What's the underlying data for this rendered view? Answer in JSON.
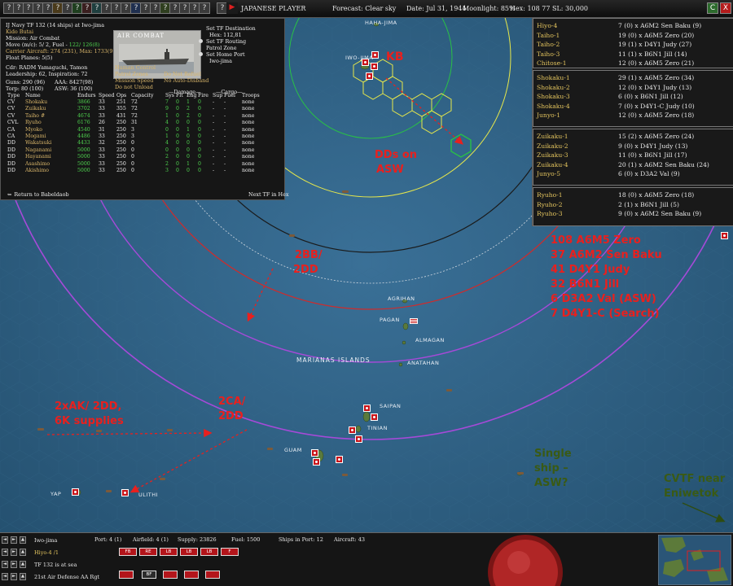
{
  "topbar": {
    "side_label": "JAPANESE PLAYER",
    "forecast": "Forecast: Clear sky",
    "date": "Date: Jul 31, 1944",
    "moonlight": "Moonlight: 85%",
    "hex": "Hex: 108  77  SL: 30,000",
    "buttons": [
      "?",
      "?",
      "?",
      "?",
      "?",
      "?",
      "?",
      "?",
      "?",
      "?",
      "?",
      "?",
      "?",
      "?",
      "?",
      "?",
      "?",
      "?",
      "?",
      "?",
      "?",
      "?",
      "▶"
    ],
    "window_buttons": [
      "C",
      "X"
    ]
  },
  "tf_panel": {
    "line1": "IJ Navy TF 132 (14 ships) at Iwo-jima",
    "line2": "Kido Butai",
    "line3": "Mission: Air Combat",
    "line4a": "Move (m/c): 5/ 2, Fuel - ",
    "line4b": "122/ 126(8)",
    "line5": "Carrier Aircraft: 274 (231), Max: 1733(90%)",
    "line6": "Float Planes: 5(5)",
    "cdr": "Cdr:  RADM  Yamaguchi, Tamon",
    "leadership": "Leadership: 62, Inspiration: 72",
    "guns": "Guns: 290 (96)",
    "torps": "Torp: 80 (100)",
    "aaa": "AAA: 8427(98)",
    "asw": "ASW: 36 (100)",
    "air_combat_title": "AIR COMBAT",
    "options": [
      "Set TF Destination",
      "Hex: 112,81",
      "Set TF Routing",
      "Patrol Zone",
      "Set Home Port",
      "Iwo-jima"
    ],
    "lower_left": [
      "Human Control",
      "Patrol Zones",
      "Mission Speed",
      "Do not Unload"
    ],
    "lower_right": [
      "Do Not Refuel",
      "No Auto-Disband"
    ],
    "damage_header": "—Damage—",
    "cargo_header": "—Cargo—",
    "columns": [
      "Type",
      "Name",
      "Endurs",
      "Speed",
      "Ops",
      "Capacity",
      "Sys",
      "Flt",
      "Eng",
      "Fire",
      "Sup",
      "Fuel",
      "Troops"
    ],
    "ships": [
      [
        "CV",
        "Shokaku",
        "3866",
        "33",
        "251",
        "72",
        "7",
        "0",
        "1",
        "0",
        "-",
        "-",
        "none"
      ],
      [
        "CV",
        "Zuikaku",
        "3702",
        "33",
        "355",
        "72",
        "9",
        "0",
        "2",
        "0",
        "-",
        "-",
        "none"
      ],
      [
        "CV",
        "Taiho #",
        "4674",
        "33",
        "431",
        "72",
        "1",
        "0",
        "2",
        "0",
        "-",
        "-",
        "none"
      ],
      [
        "CVL",
        "Ryuho",
        "6176",
        "26",
        "250",
        "31",
        "4",
        "0",
        "0",
        "0",
        "-",
        "-",
        "none"
      ],
      [
        "CA",
        "Myoko",
        "4540",
        "31",
        "250",
        "3",
        "0",
        "0",
        "1",
        "0",
        "-",
        "-",
        "none"
      ],
      [
        "CA",
        "Mogami",
        "4486",
        "33",
        "250",
        "3",
        "1",
        "0",
        "0",
        "0",
        "-",
        "-",
        "none"
      ],
      [
        "DD",
        "Wakatsuki",
        "4433",
        "32",
        "250",
        "0",
        "4",
        "0",
        "0",
        "0",
        "-",
        "-",
        "none"
      ],
      [
        "DD",
        "Naganami",
        "5000",
        "33",
        "250",
        "0",
        "0",
        "0",
        "0",
        "0",
        "-",
        "-",
        "none"
      ],
      [
        "DD",
        "Hayanami",
        "5000",
        "33",
        "250",
        "0",
        "2",
        "0",
        "0",
        "0",
        "-",
        "-",
        "none"
      ],
      [
        "DD",
        "Asashimo",
        "5000",
        "33",
        "250",
        "0",
        "2",
        "0",
        "1",
        "0",
        "-",
        "-",
        "none"
      ],
      [
        "DD",
        "Akishimo",
        "5000",
        "33",
        "250",
        "0",
        "3",
        "0",
        "0",
        "0",
        "-",
        "-",
        "none"
      ]
    ],
    "return_label": "Return to Babeldaob",
    "next_tf_label": "Next TF in Hex"
  },
  "air_groups": {
    "block1": [
      [
        "Hiyo-4",
        "7 (0) x A6M2 Sen Baku (9)"
      ],
      [
        "Taiho-1",
        "19 (0) x A6M5 Zero (20)"
      ],
      [
        "Taiho-2",
        "19 (1) x D4Y1 Judy (27)"
      ],
      [
        "Taiho-3",
        "11 (1) x B6N1 Jill (14)"
      ],
      [
        "Chitose-1",
        "12 (0) x A6M5 Zero (21)"
      ]
    ],
    "block2": [
      [
        "Shokaku-1",
        "29 (1) x A6M5 Zero (34)"
      ],
      [
        "Shokaku-2",
        "12 (0) x D4Y1 Judy (13)"
      ],
      [
        "Shokaku-3",
        "6 (0) x B6N1 Jill (12)"
      ],
      [
        "Shokaku-4",
        "7 (0) x D4Y1-C Judy (10)"
      ],
      [
        "Junyo-1",
        "12 (0) x A6M5 Zero (18)"
      ]
    ],
    "block3": [
      [
        "Zuikaku-1",
        "15 (2) x A6M5 Zero (24)"
      ],
      [
        "Zuikaku-2",
        "9 (0) x D4Y1 Judy (13)"
      ],
      [
        "Zuikaku-3",
        "11 (0) x B6N1 Jill (17)"
      ],
      [
        "Zuikaku-4",
        "20 (1) x A6M2 Sen Baku (24)"
      ],
      [
        "Junyo-5",
        "6 (0) x D3A2 Val (9)"
      ]
    ],
    "block4": [
      [
        "Ryuho-1",
        "18 (0) x A6M5 Zero (18)"
      ],
      [
        "Ryuho-2",
        "2 (1) x B6N1 Jill (5)"
      ],
      [
        "Ryuho-3",
        "9 (0) x A6M2 Sen Baku (9)"
      ]
    ]
  },
  "annotations": {
    "kb": "KB",
    "dds_on": "DDs on",
    "asw": "ASW",
    "bb_a": "2BB/",
    "bb_b": "2DD",
    "totals": [
      "108 A6M5 Zero",
      "37 A6M2 Sen Baku",
      "41 D4Y1 Judy",
      "32 B6N1 Jill",
      "6 D3A2 Val (ASW)",
      "7 D4Y1-C (Search)"
    ],
    "ak_a": "2xAK/ 2DD,",
    "ak_b": "6K supplies",
    "ca_a": "2CA/",
    "ca_b": "2DD",
    "single_a": "Single",
    "single_b": "ship –",
    "single_c": "ASW?",
    "cvtf_a": "CVTF near",
    "cvtf_b": "Eniwetok"
  },
  "map_labels": {
    "haha_jima": "HAHA-JIMA",
    "iwo_jima": "IWO-JIMA",
    "agrihan": "AGRIHAN",
    "pagan": "PAGAN",
    "almagan": "ALMAGAN",
    "marianas": "MARIANAS ISLANDS",
    "anatahan": "ANATAHAN",
    "saipan": "SAIPAN",
    "tinian": "TINIAN",
    "guam": "GUAM",
    "yap": "YAP",
    "ulithi": "ULITHI"
  },
  "bottombar": {
    "rows": [
      "Iwo-jima",
      "Hiyo-4 /1",
      "TF 132 is at sea",
      "21st Air Defense AA Rgt"
    ],
    "port": "Port: 4 (1)",
    "airfield": "Airfield: 4 (1)",
    "supply": "Supply: 23826",
    "fuel": "Fuel: 1500",
    "ships_in_port": "Ships in Port: 12",
    "aircraft": "Aircraft: 43",
    "squadron_tags": [
      "FB",
      "RE",
      "LB",
      "LB",
      "LB",
      "F"
    ],
    "bottom_tags": [
      "BF"
    ]
  },
  "colors": {
    "sea": "#2c5f84",
    "land": "#5a7a3c",
    "annotation_red": "#e8201e",
    "annotation_green": "#3a5a14",
    "range_purple": "#a64ad8",
    "range_red": "#d22a2a",
    "range_yellow": "#e8e84a",
    "range_green": "#29c046"
  }
}
